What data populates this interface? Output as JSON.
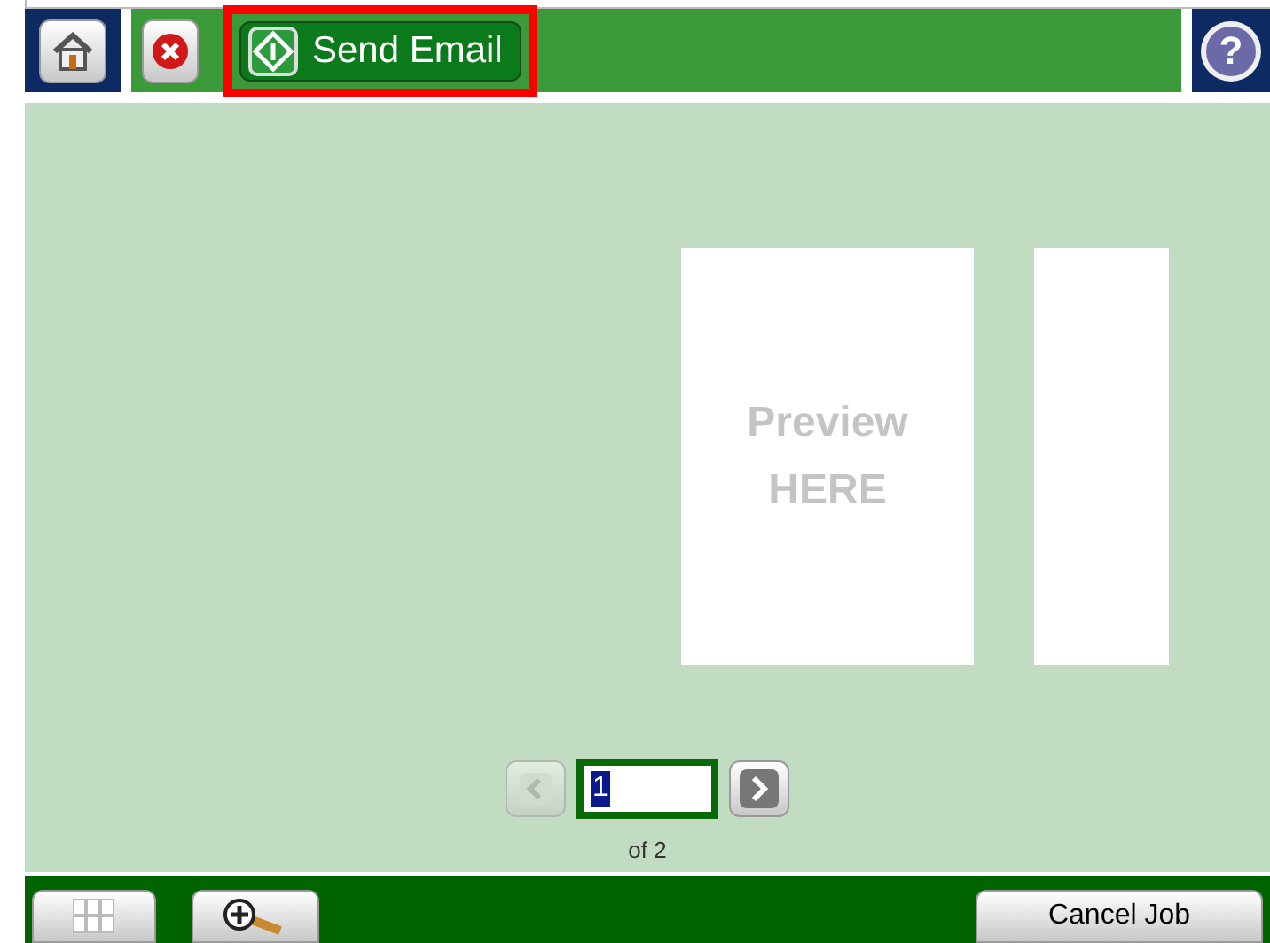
{
  "toolbar": {
    "send_button": {
      "label": "Send Email",
      "highlighted": true
    },
    "help_symbol": "?"
  },
  "preview": {
    "pages": [
      {
        "kind": "labeled",
        "text_lines": [
          "Preview",
          "HERE"
        ]
      },
      {
        "kind": "narrow"
      }
    ]
  },
  "pager": {
    "prev_disabled": true,
    "next_disabled": false,
    "page_value": "1",
    "page_count": "of 2"
  },
  "bottom_bar": {
    "cancel_label": "Cancel Job"
  }
}
